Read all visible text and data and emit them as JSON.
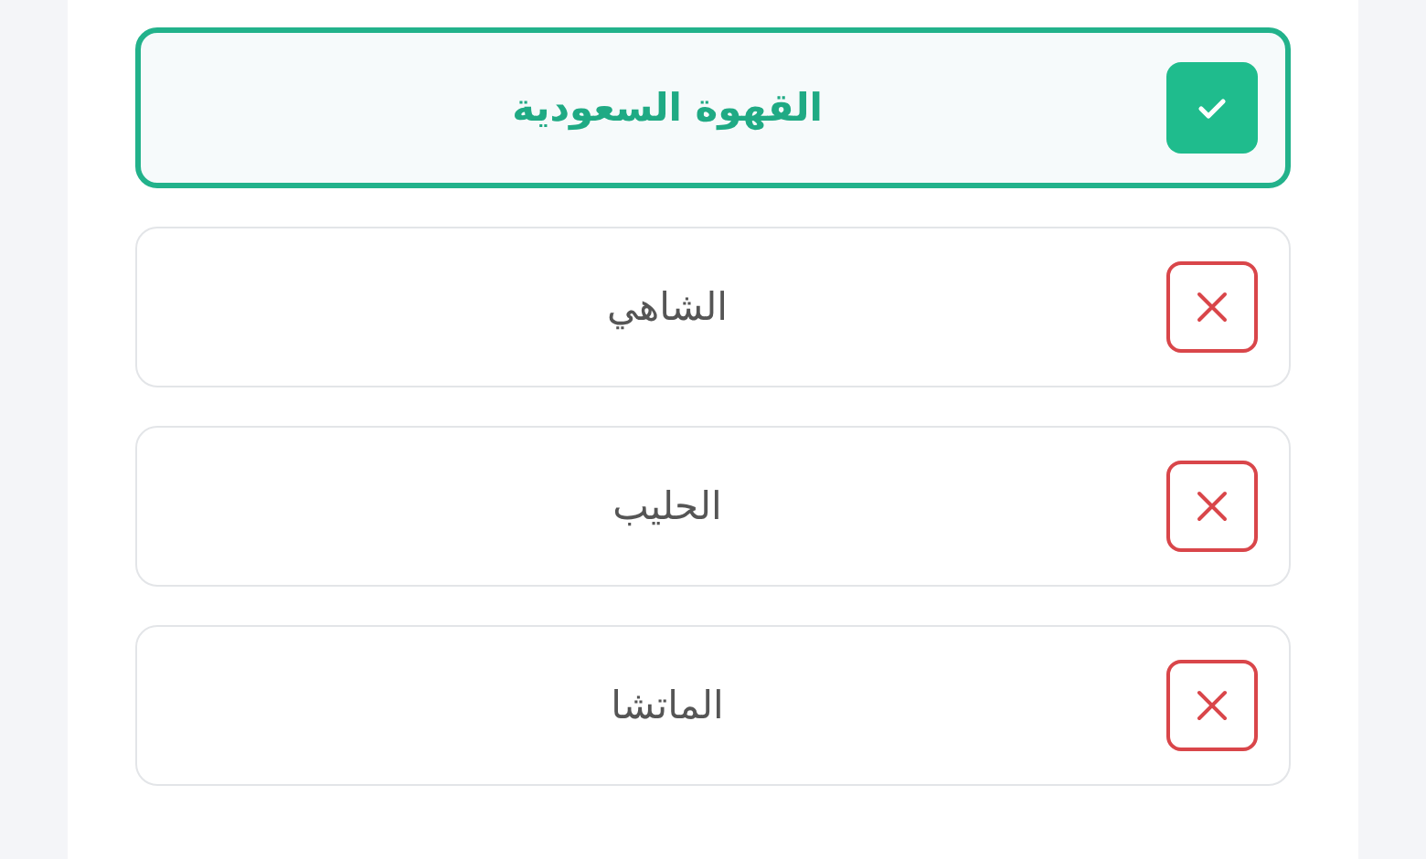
{
  "options": [
    {
      "label": "القهوة السعودية",
      "correct": true
    },
    {
      "label": "الشاهي",
      "correct": false
    },
    {
      "label": "الحليب",
      "correct": false
    },
    {
      "label": "الماتشا",
      "correct": false
    }
  ]
}
